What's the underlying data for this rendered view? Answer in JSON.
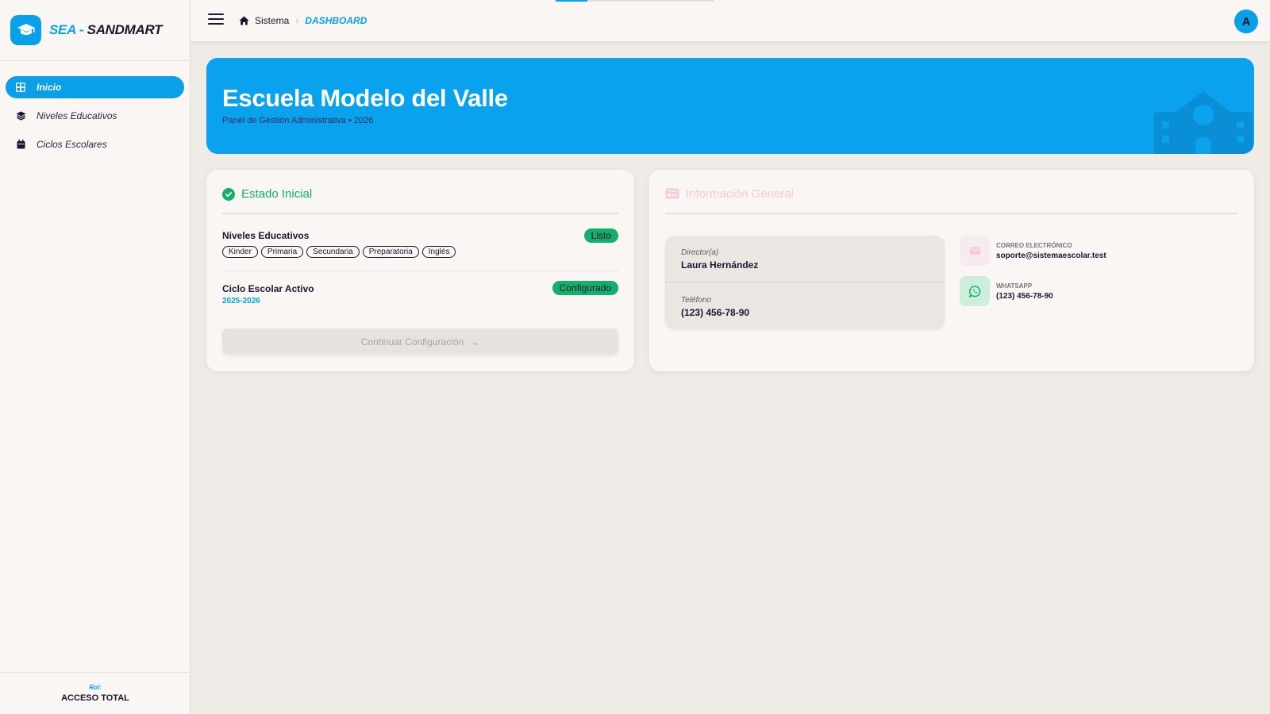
{
  "brand": {
    "part1": "SEA",
    "separator": " - ",
    "part2": "SANDMART"
  },
  "sidebar": {
    "items": [
      {
        "label": "Inicio",
        "icon": "dashboard-grid-icon"
      },
      {
        "label": "Niveles Educativos",
        "icon": "layers-icon"
      },
      {
        "label": "Ciclos Escolares",
        "icon": "calendar-icon"
      }
    ],
    "role_label": "Rol:",
    "role_value": "ACCESO TOTAL"
  },
  "topbar": {
    "breadcrumb_root": "Sistema",
    "breadcrumb_current": "DASHBOARD",
    "avatar_initial": "A",
    "loading_progress": 0.2
  },
  "hero": {
    "title": "Escuela Modelo del Valle",
    "subtitle": "Panel de Gestión Administrativa • 2026"
  },
  "estado": {
    "title": "Estado Inicial",
    "niveles_title": "Niveles Educativos",
    "niveles_badge": "Listo",
    "niveles_tags": [
      "Kinder",
      "Primaria",
      "Secundaria",
      "Preparatoria",
      "Inglés"
    ],
    "ciclo_title": "Ciclo Escolar Activo",
    "ciclo_value": "2025-2026",
    "ciclo_badge": "Configurado",
    "cta_label": "Continuar Configuración"
  },
  "info": {
    "title": "Información General",
    "director_label": "Director(a)",
    "director_value": "Laura Hernández",
    "phone_label": "Teléfono",
    "phone_value": "(123) 456-78-90",
    "email_label": "CORREO ELECTRÓNICO",
    "email_value": "soporte@sistemaescolar.test",
    "whatsapp_label": "WHATSAPP",
    "whatsapp_value": "(123) 456-78-90"
  },
  "colors": {
    "accent": "#0aa0e8",
    "success": "#12b06a",
    "info_title": "#f7c9dc",
    "text": "#1b1530",
    "background": "#efebe7"
  }
}
